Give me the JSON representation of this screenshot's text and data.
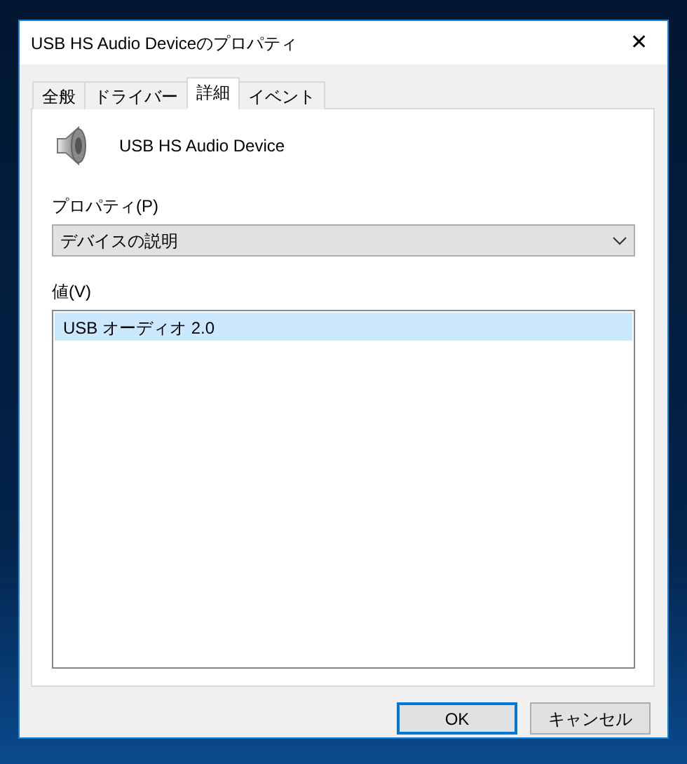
{
  "window": {
    "title": "USB HS Audio Deviceのプロパティ",
    "close": "✕"
  },
  "tabs": [
    {
      "label": "全般",
      "selected": false
    },
    {
      "label": "ドライバー",
      "selected": false
    },
    {
      "label": "詳細",
      "selected": true
    },
    {
      "label": "イベント",
      "selected": false
    }
  ],
  "device": {
    "name": "USB HS Audio Device"
  },
  "property": {
    "label": "プロパティ(P)",
    "value": "デバイスの説明"
  },
  "values": {
    "label": "値(V)",
    "items": [
      {
        "text": "USB オーディオ 2.0",
        "selected": true
      }
    ]
  },
  "buttons": [
    {
      "label": "OK",
      "default": true
    },
    {
      "label": "キャンセル",
      "default": false
    }
  ]
}
